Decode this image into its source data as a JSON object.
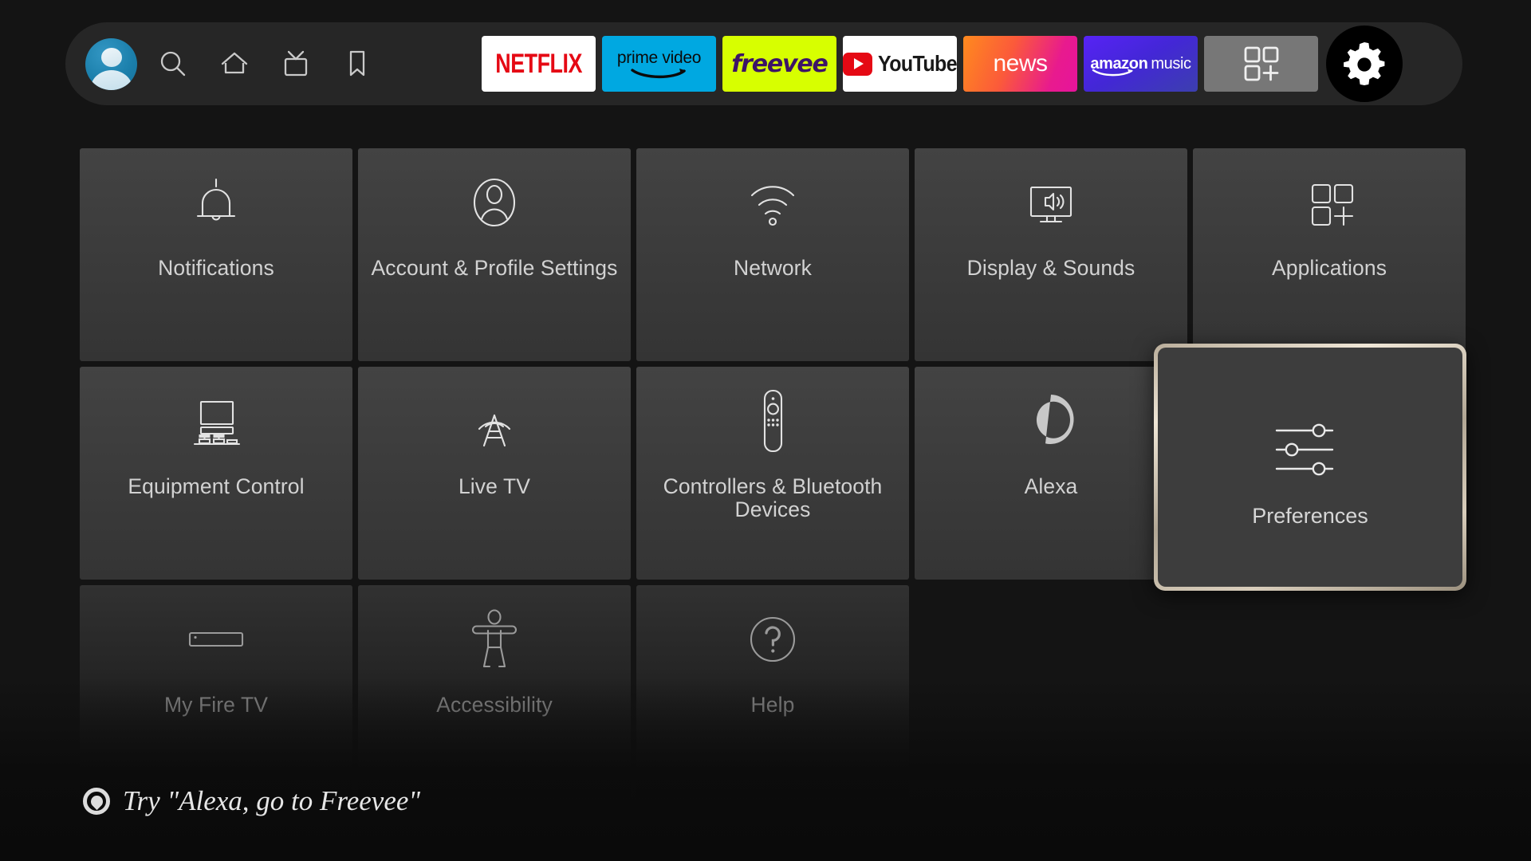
{
  "topbar": {
    "profile": {
      "name": "profile-avatar",
      "label": "Profile"
    },
    "nav_items": [
      {
        "icon": "search-icon",
        "label": "Search"
      },
      {
        "icon": "home-icon",
        "label": "Home"
      },
      {
        "icon": "live-tv-icon",
        "label": "Live TV"
      },
      {
        "icon": "bookmark-icon",
        "label": "Watchlist"
      }
    ],
    "apps": [
      {
        "id": "netflix",
        "label": "NETFLIX",
        "bg": "#ffffff",
        "fg": "#e50914"
      },
      {
        "id": "prime-video",
        "label": "prime video",
        "bg": "#00a8e1",
        "fg": "#0b0b0b"
      },
      {
        "id": "freevee",
        "label": "freevee",
        "bg": "#d7ff00",
        "fg": "#3d1466"
      },
      {
        "id": "youtube",
        "label": "YouTube",
        "bg": "#ffffff",
        "fg": "#191919"
      },
      {
        "id": "news",
        "label": "news",
        "bg": "#f3611f",
        "fg": "#ffffff"
      },
      {
        "id": "amazon-music",
        "label_bold": "amazon",
        "label_light": "music",
        "bg": "#4a26e0",
        "fg": "#ffffff"
      }
    ],
    "apps_grid_button": {
      "icon": "apps-grid-plus-icon",
      "label": "Apps"
    },
    "settings_button": {
      "icon": "gear-icon",
      "label": "Settings"
    }
  },
  "grid": {
    "rows": [
      [
        {
          "icon": "bell-icon",
          "label": "Notifications"
        },
        {
          "icon": "person-circle-icon",
          "label": "Account & Profile Settings"
        },
        {
          "icon": "wifi-icon",
          "label": "Network"
        },
        {
          "icon": "tv-speaker-icon",
          "label": "Display & Sounds"
        },
        {
          "icon": "apps-grid-plus-icon",
          "label": "Applications"
        }
      ],
      [
        {
          "icon": "tv-equipment-icon",
          "label": "Equipment Control"
        },
        {
          "icon": "broadcast-tower-icon",
          "label": "Live TV"
        },
        {
          "icon": "remote-control-icon",
          "label": "Controllers & Bluetooth Devices"
        },
        {
          "icon": "alexa-logo-icon",
          "label": "Alexa"
        },
        {
          "icon": "sliders-icon",
          "label": "Preferences"
        }
      ],
      [
        {
          "icon": "fire-stick-icon",
          "label": "My Fire TV"
        },
        {
          "icon": "accessibility-icon",
          "label": "Accessibility"
        },
        {
          "icon": "question-circle-icon",
          "label": "Help"
        }
      ]
    ]
  },
  "focused_tile": {
    "icon": "sliders-icon",
    "label": "Preferences",
    "highlight_color": "#cfc4b1"
  },
  "alexa_hint": {
    "icon": "alexa-ring-icon",
    "text": "Try \"Alexa, go to Freevee\""
  }
}
